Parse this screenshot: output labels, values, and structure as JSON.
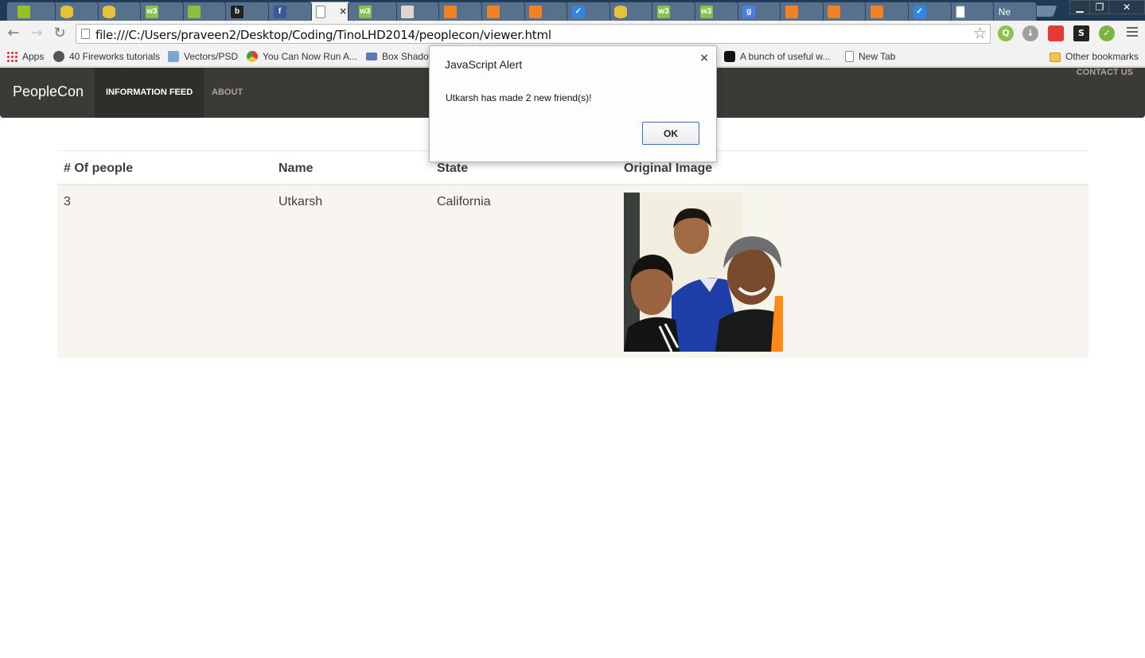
{
  "browser": {
    "tabs": [
      {
        "icon": "android-icon",
        "color": "#97c024",
        "glyph": ""
      },
      {
        "icon": "database-icon",
        "color": "#e8c13a",
        "glyph": ""
      },
      {
        "icon": "database-icon",
        "color": "#e8c13a",
        "glyph": ""
      },
      {
        "icon": "w3-icon",
        "color": "#8ac249",
        "glyph": "w3"
      },
      {
        "icon": "android-robot-icon",
        "color": "#8bbf3c",
        "glyph": ""
      },
      {
        "icon": "b-icon",
        "color": "#222222",
        "glyph": "b"
      },
      {
        "icon": "facebook-icon",
        "color": "#3b5998",
        "glyph": "f"
      },
      {
        "icon": "page-icon",
        "color": "#ffffff",
        "glyph": "",
        "active": true
      },
      {
        "icon": "w3-icon",
        "color": "#8ac249",
        "glyph": "w3"
      },
      {
        "icon": "palette-icon",
        "color": "#e0d6cc",
        "glyph": ""
      },
      {
        "icon": "stack-icon",
        "color": "#f48024",
        "glyph": ""
      },
      {
        "icon": "stack-icon",
        "color": "#f48024",
        "glyph": ""
      },
      {
        "icon": "stack-icon",
        "color": "#f48024",
        "glyph": ""
      },
      {
        "icon": "check-icon",
        "color": "#2f86e3",
        "glyph": "✓"
      },
      {
        "icon": "database-icon",
        "color": "#e8c13a",
        "glyph": ""
      },
      {
        "icon": "w3-icon",
        "color": "#8ac249",
        "glyph": "w3"
      },
      {
        "icon": "w3-icon",
        "color": "#8ac249",
        "glyph": "w3"
      },
      {
        "icon": "google-icon",
        "color": "#4a7fe8",
        "glyph": "g"
      },
      {
        "icon": "stack-icon",
        "color": "#f48024",
        "glyph": ""
      },
      {
        "icon": "stack-icon",
        "color": "#f48024",
        "glyph": ""
      },
      {
        "icon": "stack-icon",
        "color": "#f48024",
        "glyph": ""
      },
      {
        "icon": "check-icon",
        "color": "#2f86e3",
        "glyph": "✓"
      },
      {
        "icon": "page-icon",
        "color": "#ffffff",
        "glyph": ""
      },
      {
        "icon": "text-tab",
        "color": "#57718d",
        "glyph": "Ne"
      }
    ],
    "active_tab_close": "×",
    "window_controls": {
      "minimize": "▁",
      "restore": "❐",
      "close": "✕"
    },
    "url": "file:///C:/Users/praveen2/Desktop/Coding/TinoLHD2014/peoplecon/viewer.html",
    "bookmarks": [
      {
        "label": "Apps",
        "icon": "apps-icon",
        "color": "#e53935"
      },
      {
        "label": "40 Fireworks tutorials",
        "icon": "fireworks-icon",
        "color": "#555555"
      },
      {
        "label": "Vectors/PSD",
        "icon": "cloud-icon",
        "color": "#7aa6d6"
      },
      {
        "label": "You Can Now Run A...",
        "icon": "chrome-icon",
        "color": "#e3b22b"
      },
      {
        "label": "Box Shadow",
        "icon": "box-icon",
        "color": "#5b7bb5"
      },
      {
        "label": "A bunch of useful w...",
        "icon": "codepen-icon",
        "color": "#111111"
      },
      {
        "label": "New Tab",
        "icon": "page-icon",
        "color": "#ffffff"
      }
    ],
    "other_bookmarks": "Other bookmarks"
  },
  "navbar": {
    "brand": "PeopleCon",
    "items": [
      {
        "label": "INFORMATION FEED",
        "active": true
      },
      {
        "label": "ABOUT",
        "active": false
      }
    ],
    "contact": "CONTACT US"
  },
  "table": {
    "headers": [
      "# Of people",
      "Name",
      "State",
      "Original Image"
    ],
    "rows": [
      {
        "count": "3",
        "name": "Utkarsh",
        "state": "California"
      }
    ]
  },
  "alert": {
    "title": "JavaScript Alert",
    "message": "Utkarsh has made 2 new friend(s)!",
    "ok_label": "OK",
    "close_glyph": "×"
  }
}
